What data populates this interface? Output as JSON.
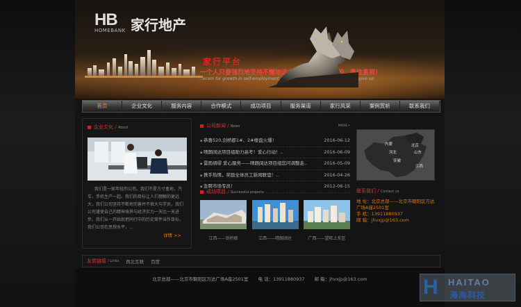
{
  "brand": {
    "logo_letters": "HB",
    "logo_sub": "HOMEBANK",
    "name_cn": "家行地产"
  },
  "banner": {
    "slogan_title": "家行平台",
    "slogan_line": "一个人只要强烈地坚持不懈地追求，他就能达到目的，勇往直前！",
    "slogan_en": "...ecom for growth in self-employment, like wolves, the go all out and never give up"
  },
  "nav": {
    "items": [
      "首页",
      "企业文化",
      "服务内容",
      "合作模式",
      "成功项目",
      "服务渠道",
      "家行风采",
      "案例赏析",
      "联系我们"
    ],
    "active_index": 0
  },
  "about": {
    "title": "企业文化",
    "title_en": "About",
    "text": "我们是一家年轻的公司。我们不是方寸盒地，汽车，手机生产一起。我们的目标让人们理解的更远大，我们公司坚持不断地完善并不很大与学员，我们公司谨使自己的精神境界与经济实力一天比一天进步。我们从一开始就把同行中的历史案件当作目标，我们公司在思想水平，...",
    "more": "详情 >>"
  },
  "news": {
    "title": "公司新闻",
    "title_en": "News",
    "more": "MORE+",
    "items": [
      {
        "title": "恭喜520,剑桥郡1#、2#楼盘火爆！",
        "date": "2016-06-12"
      },
      {
        "title": "晴朗阔达项目组助力高考！爱心行动！..",
        "date": "2016-06-09"
      },
      {
        "title": "雷雨绸缪 爱心服务——晴朗阔达项目组您问调整走..",
        "date": "2016-05-09"
      },
      {
        "title": "携手热情，奖励全体员工新闻联谊！..",
        "date": "2016-04-26"
      },
      {
        "title": "急聘市场专员！",
        "date": "2012-06-15"
      }
    ]
  },
  "projects": {
    "title": "成功项目",
    "title_en": "Successful projects",
    "items": [
      {
        "caption": "江西——剑桥郡"
      },
      {
        "caption": "江西——晴朗阔达"
      },
      {
        "caption": "广西——望旺上东区"
      }
    ]
  },
  "map": {
    "labels": [
      "内蒙",
      "北京",
      "河北",
      "山东",
      "安徽",
      "江西"
    ]
  },
  "contact": {
    "title": "联系我们",
    "title_en": "Contact us",
    "address_1": "地  址：北京总部——北京市朝阳区万达",
    "address_2": "广场A座2501室",
    "phone": "手  机：13911880937",
    "email": "邮  箱：jhvxjp@163.com"
  },
  "links": {
    "title": "友情链接",
    "title_en": "Links",
    "items": [
      "再北互联",
      "百度"
    ]
  },
  "footer": {
    "address": "北京总部——北京市朝阳区万达广场A座2501室",
    "phone": "电  话：13911880937",
    "email": "邮  箱：jhvxjp@163.com"
  },
  "watermark": {
    "en": "HAITAO",
    "cn": "海淘科技"
  },
  "colors": {
    "accent": "#e07a10",
    "title_red": "#cc2222",
    "background": "#141414"
  }
}
